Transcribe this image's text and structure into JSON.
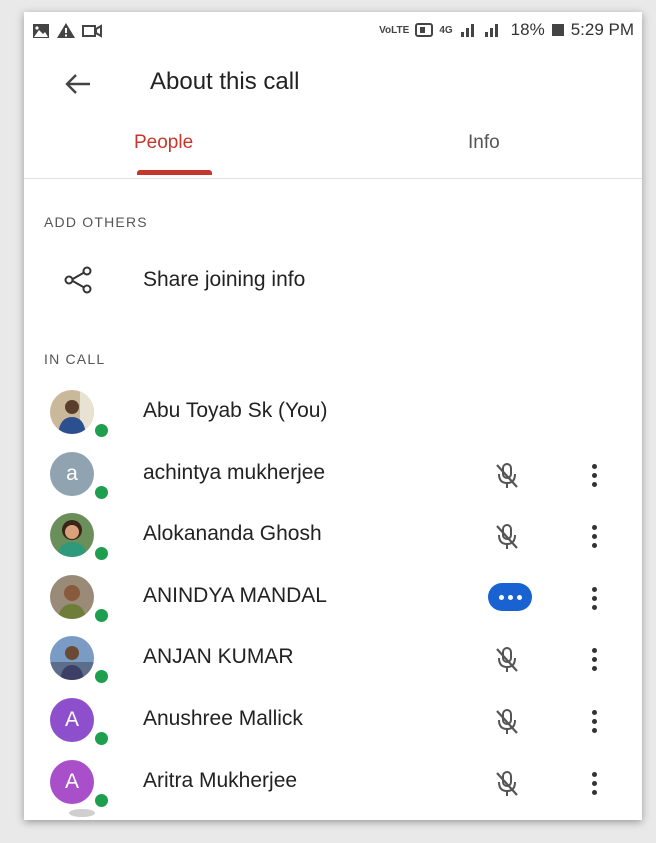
{
  "status_bar": {
    "volte": "VoLTE",
    "signal_text": "4G",
    "battery": "18%",
    "time": "5:29 PM",
    "icons": [
      "gallery-icon",
      "warning-icon",
      "video-icon",
      "sim-icon",
      "signal-icon",
      "battery-icon"
    ]
  },
  "header": {
    "title": "About this call"
  },
  "tabs": [
    {
      "label": "People",
      "active": true
    },
    {
      "label": "Info",
      "active": false
    }
  ],
  "sections": {
    "add_others": "ADD OTHERS",
    "share_label": "Share joining info",
    "in_call": "IN CALL"
  },
  "participants": [
    {
      "name": "Abu Toyab Sk (You)",
      "avatar": "photo",
      "status": "none"
    },
    {
      "name": "achintya mukherjee",
      "avatar": "a",
      "status": "muted"
    },
    {
      "name": "Alokananda Ghosh",
      "avatar": "photo",
      "status": "muted"
    },
    {
      "name": "ANINDYA MANDAL",
      "avatar": "photo",
      "status": "speaking"
    },
    {
      "name": "ANJAN KUMAR",
      "avatar": "photo",
      "status": "muted"
    },
    {
      "name": "Anushree Mallick",
      "avatar": "A",
      "status": "muted"
    },
    {
      "name": "Aritra Mukherjee",
      "avatar": "A",
      "status": "muted"
    }
  ],
  "colors": {
    "accent": "#c5372c",
    "online": "#1e9e4f",
    "speaking": "#1a62d2",
    "avatar_gray": "#8fa3b1",
    "avatar_purple": "#8e4fcc"
  }
}
